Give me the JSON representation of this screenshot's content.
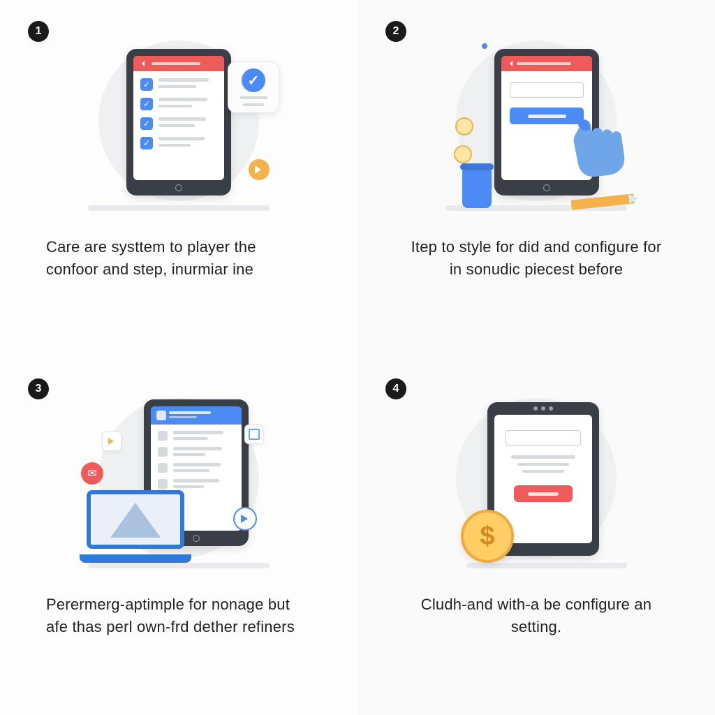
{
  "steps": [
    {
      "num": "1",
      "caption": "Care are systtem to player the confoor and step, inurmiar ine"
    },
    {
      "num": "2",
      "caption": "Itep to style for did and configure for in sonudic piecest before"
    },
    {
      "num": "3",
      "caption": "Perermerg-aptimple for nonage but afe thas perl own-frd dether refiners"
    },
    {
      "num": "4",
      "caption": "Cludh-and with-a be configure an setting."
    }
  ],
  "icons": {
    "check": "✓",
    "mail": "✉",
    "dollar": "$"
  }
}
